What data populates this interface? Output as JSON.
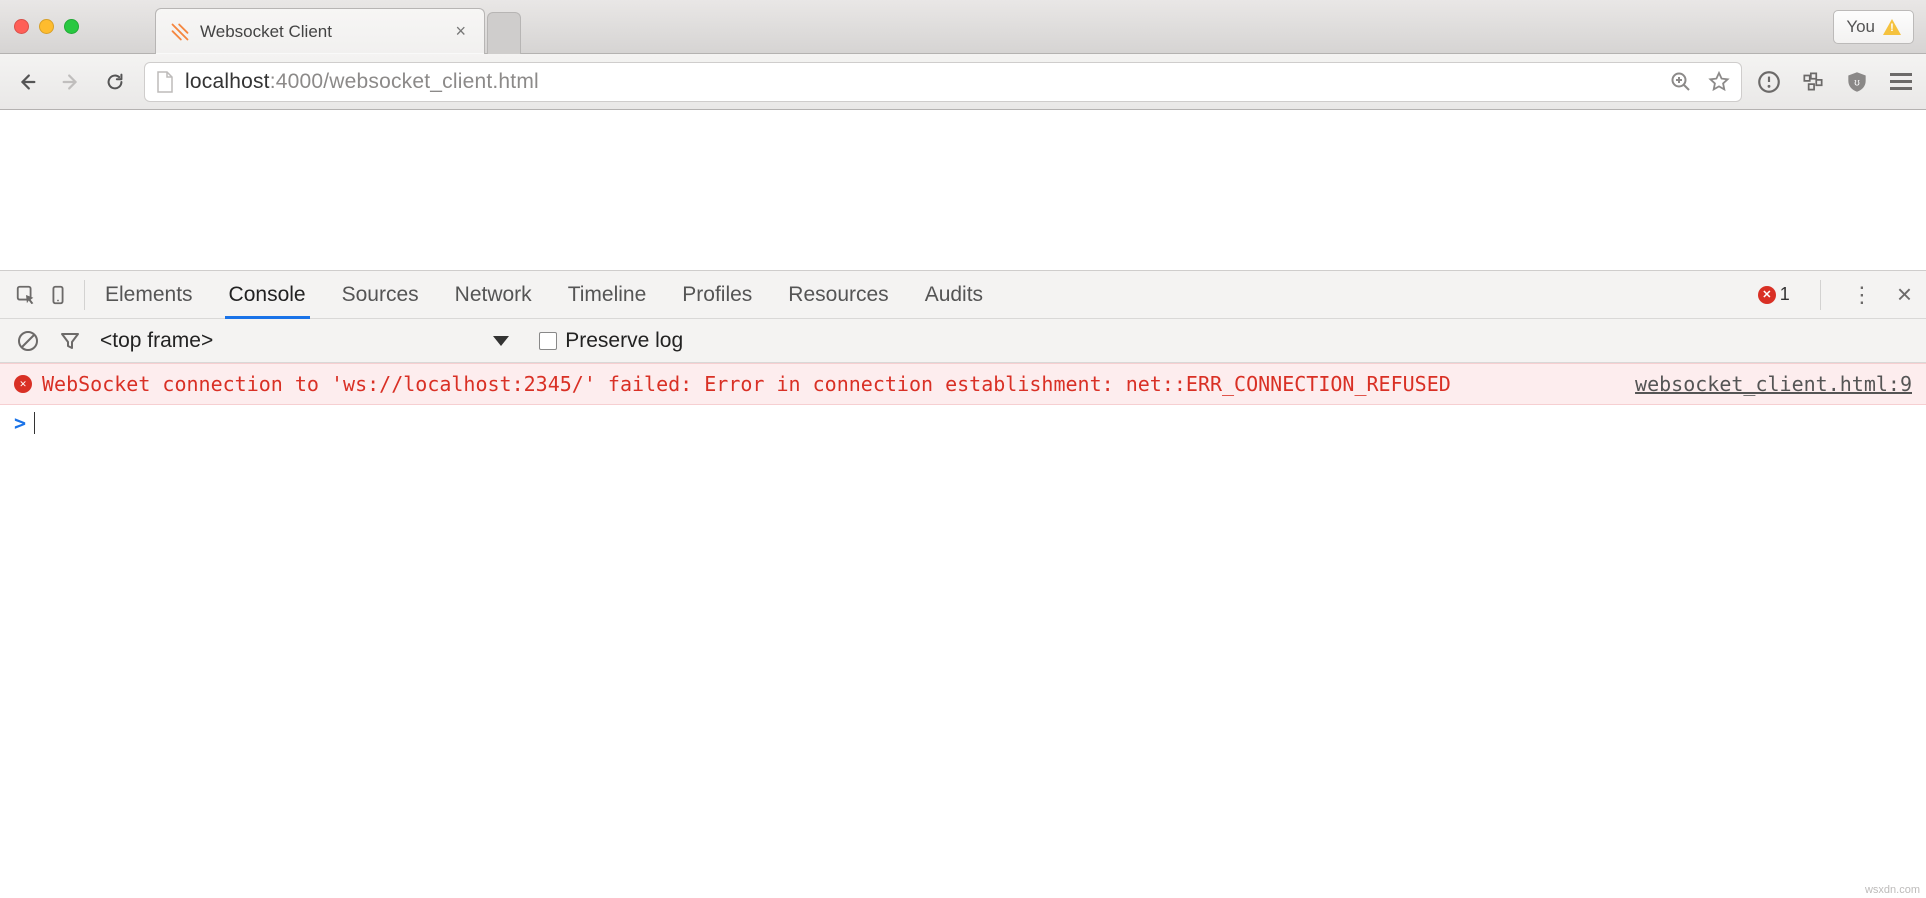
{
  "window": {
    "tab_title": "Websocket Client",
    "profile_button": "You"
  },
  "toolbar": {
    "url_host": "localhost",
    "url_port_path": ":4000/websocket_client.html"
  },
  "devtools": {
    "panels": [
      "Elements",
      "Console",
      "Sources",
      "Network",
      "Timeline",
      "Profiles",
      "Resources",
      "Audits"
    ],
    "active_panel": "Console",
    "error_count": "1",
    "frame_selector": "<top frame>",
    "preserve_log_label": "Preserve log",
    "error_message": "WebSocket connection to 'ws://localhost:2345/' failed: Error in connection establishment: net::ERR_CONNECTION_REFUSED",
    "error_source": "websocket_client.html:9",
    "prompt_symbol": ">"
  },
  "watermark": "wsxdn.com"
}
